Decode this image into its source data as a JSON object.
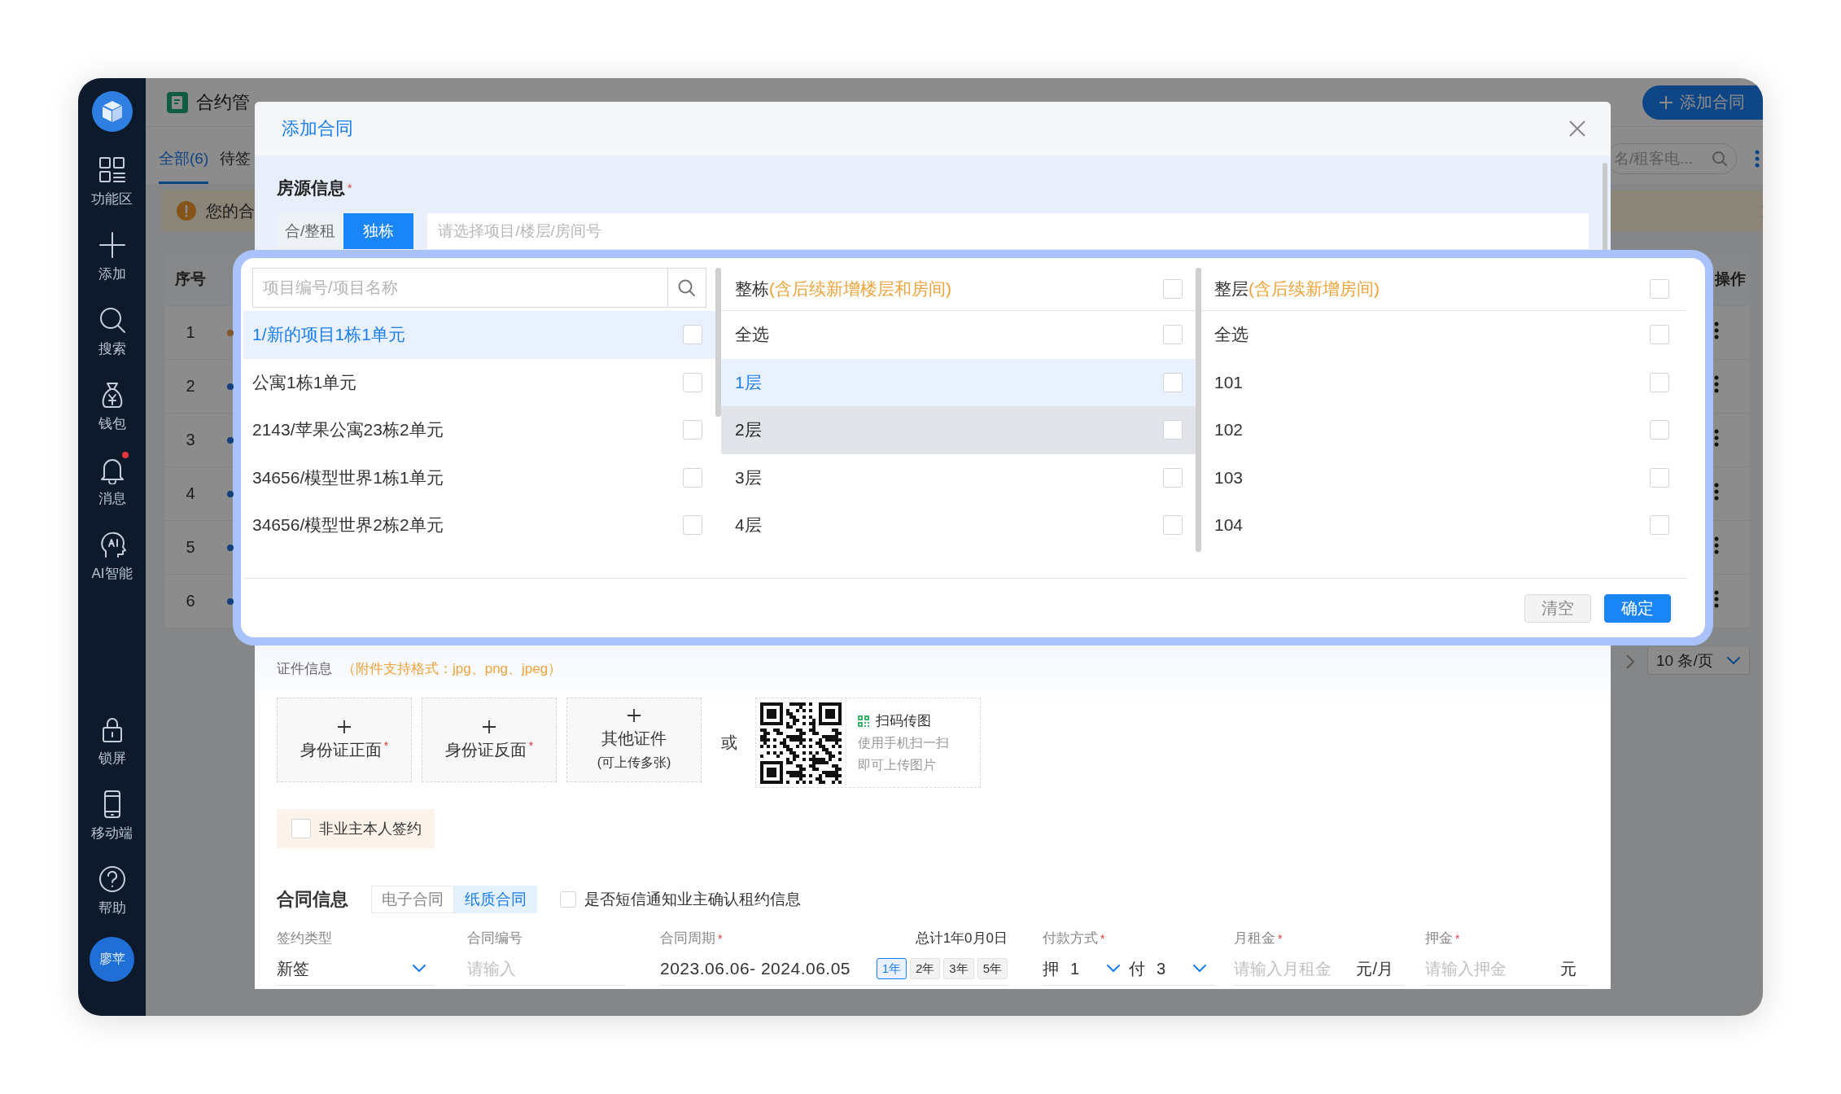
{
  "sidebar": {
    "items": [
      {
        "label": "功能区",
        "badge": false
      },
      {
        "label": "添加",
        "badge": false
      },
      {
        "label": "搜索",
        "badge": false
      },
      {
        "label": "钱包",
        "badge": false
      },
      {
        "label": "消息",
        "badge": true
      },
      {
        "label": "AI智能",
        "badge": false
      }
    ],
    "bottom_items": [
      {
        "label": "锁屏"
      },
      {
        "label": "移动端"
      },
      {
        "label": "帮助"
      }
    ],
    "avatar": "廖苹"
  },
  "header": {
    "title": "合约管",
    "add_button": "添加合同"
  },
  "tabs": [
    {
      "label": "全部(6)",
      "selected": true
    },
    {
      "label": "待签",
      "selected": false
    }
  ],
  "search": {
    "placeholder": "名/租客电..."
  },
  "alert": {
    "text": "您的合"
  },
  "table": {
    "columns": [
      "序号",
      "操作"
    ],
    "rows": [
      {
        "number": "1",
        "color": "#805829"
      },
      {
        "number": "2",
        "color": "#13407a"
      },
      {
        "number": "3",
        "color": "#13407a"
      },
      {
        "number": "4",
        "color": "#13407a"
      },
      {
        "number": "5",
        "color": "#13407a"
      },
      {
        "number": "6",
        "color": "#13407a"
      }
    ]
  },
  "pagination": {
    "page_size": "10 条/页"
  },
  "modal": {
    "title": "添加合同",
    "property": {
      "title": "房源信息",
      "mark": "*",
      "modes": [
        {
          "label": "合/整租",
          "selected": false
        },
        {
          "label": "独栋",
          "selected": true
        }
      ],
      "placeholder": "请选择项目/楼层/房间号"
    },
    "picker": {
      "search_placeholder": "项目编号/项目名称",
      "projects": [
        {
          "label": "1/新的项目1栋1单元",
          "selected": true,
          "checked": false
        },
        {
          "label": "公寓1栋1单元",
          "selected": false,
          "checked": false
        },
        {
          "label": "2143/苹果公寓23栋2单元",
          "selected": false,
          "checked": false
        },
        {
          "label": "34656/模型世界1栋1单元",
          "selected": false,
          "checked": false
        },
        {
          "label": "34656/模型世界2栋2单元",
          "selected": false,
          "checked": false
        }
      ],
      "building": {
        "title": "整栋",
        "note": "(含后续新增楼层和房间)",
        "checked": false,
        "items": [
          {
            "label": "全选",
            "selected": false,
            "hovered": false,
            "checked": false
          },
          {
            "label": "1层",
            "selected": true,
            "hovered": false,
            "checked": false
          },
          {
            "label": "2层",
            "selected": false,
            "hovered": true,
            "checked": false
          },
          {
            "label": "3层",
            "selected": false,
            "hovered": false,
            "checked": false
          },
          {
            "label": "4层",
            "selected": false,
            "hovered": false,
            "checked": false
          }
        ]
      },
      "floor": {
        "title": "整层",
        "note": "(含后续新增房间)",
        "checked": false,
        "items": [
          {
            "label": "全选",
            "selected": false,
            "checked": false
          },
          {
            "label": "101",
            "selected": false,
            "checked": false
          },
          {
            "label": "102",
            "selected": false,
            "checked": false
          },
          {
            "label": "103",
            "selected": false,
            "checked": false
          },
          {
            "label": "104",
            "selected": false,
            "checked": false
          }
        ]
      },
      "clear_button": "清空",
      "confirm_button": "确定"
    },
    "documents": {
      "title": "证件信息",
      "note": "（附件支持格式：jpg、png、jpeg）",
      "uploads": [
        {
          "label": "身份证正面",
          "mark": "*"
        },
        {
          "label": "身份证反面",
          "mark": "*"
        },
        {
          "label": "其他证件",
          "sublabel": "(可上传多张)"
        }
      ],
      "or": "或",
      "qr": {
        "title": "扫码传图",
        "lines": [
          "使用手机扫一扫",
          "即可上传图片"
        ]
      }
    },
    "proxy_sign": {
      "label": "非业主本人签约",
      "checked": false
    },
    "contract": {
      "title": "合同信息",
      "types": [
        {
          "label": "电子合同",
          "selected": false
        },
        {
          "label": "纸质合同",
          "selected": true
        }
      ],
      "sms": {
        "label": "是否短信通知业主确认租约信息",
        "checked": false
      },
      "fields": [
        {
          "kind": "select",
          "label": "签约类型",
          "value": "新签"
        },
        {
          "kind": "input",
          "label": "合同编号",
          "placeholder": "请输入"
        },
        {
          "kind": "period",
          "label": "合同周期",
          "mark": "*",
          "total": "总计1年0月0日",
          "value": "2023.06.06- 2024.06.05",
          "options": [
            {
              "label": "1年",
              "selected": true
            },
            {
              "label": "2年",
              "selected": false
            },
            {
              "label": "3年",
              "selected": false
            },
            {
              "label": "5年",
              "selected": false
            }
          ]
        },
        {
          "kind": "payment",
          "label": "付款方式",
          "mark": "*",
          "parts": [
            {
              "prefix": "押",
              "value": "1"
            },
            {
              "prefix": "付",
              "value": "3"
            }
          ]
        },
        {
          "kind": "input",
          "label": "月租金",
          "mark": "*",
          "placeholder": "请输入月租金",
          "unit": "元/月"
        },
        {
          "kind": "input",
          "label": "押金",
          "mark": "*",
          "placeholder": "请输入押金",
          "unit": "元"
        }
      ]
    }
  }
}
